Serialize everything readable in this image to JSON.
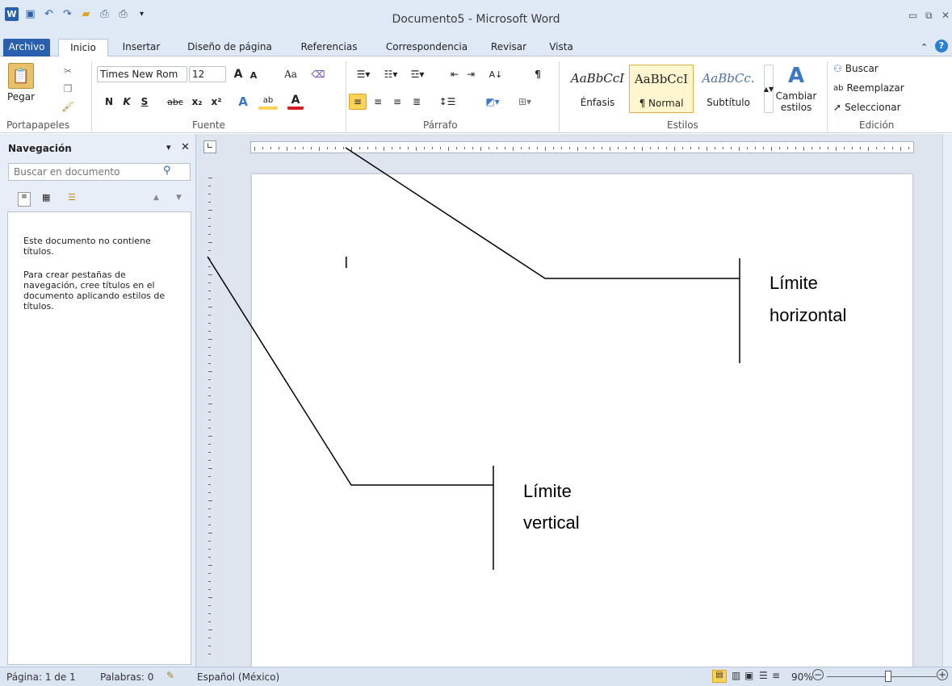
{
  "window": {
    "title": "Documento5 - Microsoft Word",
    "icons": [
      "word-icon",
      "save-icon",
      "undo-icon",
      "redo-icon",
      "open-icon",
      "print-preview-icon",
      "print-icon",
      "customize-qat-icon"
    ]
  },
  "tabs": [
    "Archivo",
    "Inicio",
    "Insertar",
    "Diseño de página",
    "Referencias",
    "Correspondencia",
    "Revisar",
    "Vista"
  ],
  "ribbon": {
    "clipboard": {
      "paste_label": "Pegar",
      "group_label": "Portapapeles"
    },
    "font": {
      "font_name": "Times New Rom",
      "font_size": "12",
      "bold": "N",
      "italic": "K",
      "underline": "S",
      "strike": "abc",
      "sub": "x₂",
      "sup": "x²",
      "group_label": "Fuente",
      "grow": "A",
      "shrink": "A",
      "case": "Aa"
    },
    "paragraph": {
      "group_label": "Párrafo"
    },
    "styles": {
      "items": [
        {
          "sample": "AaBbCcI",
          "name": "Énfasis"
        },
        {
          "sample": "AaBbCcI",
          "name": "¶ Normal"
        },
        {
          "sample": "AaBbCc.",
          "name": "Subtítulo"
        }
      ],
      "change_label": "Cambiar",
      "change_label2": "estilos",
      "group_label": "Estilos"
    },
    "editing": {
      "find": "Buscar",
      "replace": "Reemplazar",
      "select": "Seleccionar",
      "group_label": "Edición"
    }
  },
  "navigation": {
    "title": "Navegación",
    "search_placeholder": "Buscar en documento",
    "message1": "Este documento no contiene títulos.",
    "message2": "Para crear pestañas de navegación, cree títulos en el documento aplicando estilos de títulos."
  },
  "document": {
    "cursor": "I"
  },
  "callouts": {
    "horizontal_line1": "Límite",
    "horizontal_line2": "horizontal",
    "vertical_line1": "Límite",
    "vertical_line2": "vertical"
  },
  "status": {
    "page": "Página: 1 de 1",
    "words": "Palabras: 0",
    "language": "Español (México)",
    "zoom": "90%"
  },
  "colors": {
    "file_tab": "#2a5fae",
    "ribbon_bg": "#dfe9f5",
    "highlight": "#ffd35a"
  }
}
